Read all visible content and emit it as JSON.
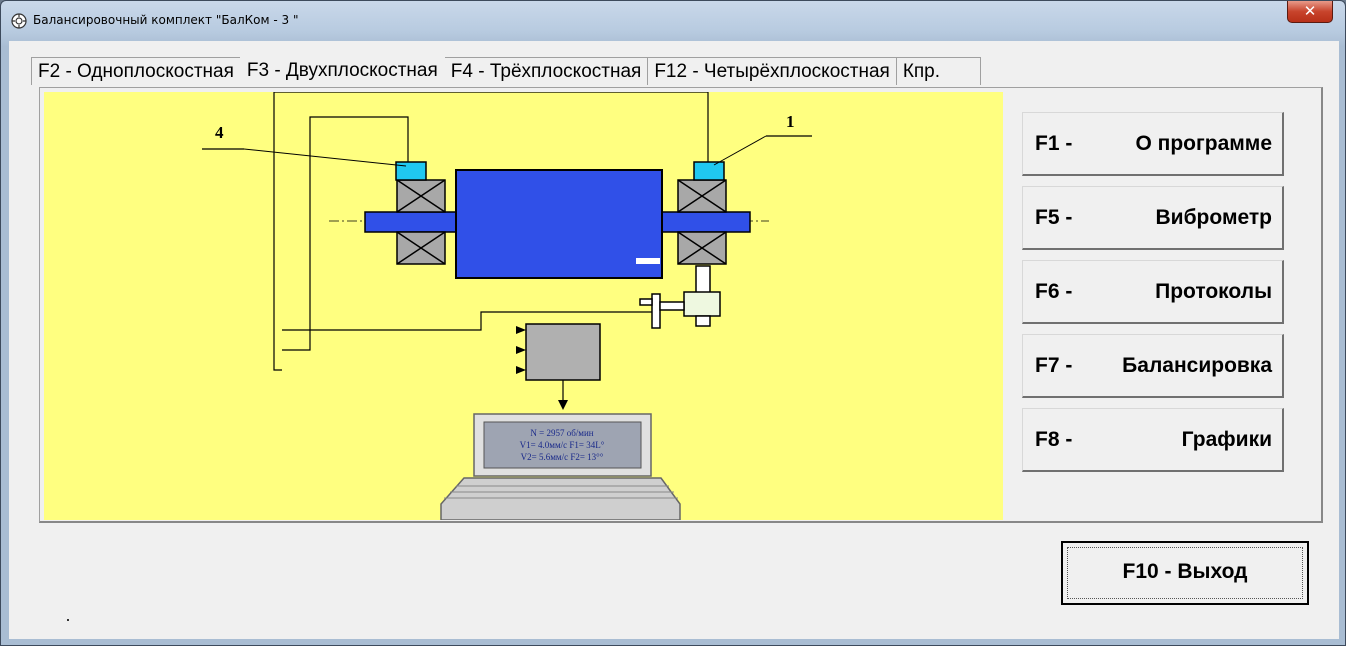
{
  "window": {
    "title": "Балансировочный комплект \"БалКом - 3 \"",
    "close_glyph": "✕"
  },
  "tabs": [
    {
      "label": "F2 - Одноплоскостная",
      "active": false
    },
    {
      "label": "F3 - Двухплоскостная",
      "active": true
    },
    {
      "label": "F4 - Трёхплоскостная",
      "active": false
    },
    {
      "label": "F12 - Четырёхплоскостная",
      "active": false
    },
    {
      "label": "Кпр.",
      "active": false
    }
  ],
  "diagram": {
    "sensor_labels": [
      "4",
      "1"
    ],
    "screen_lines": [
      "N = 2957 об/мин",
      "V1= 4.0мм/с   F1= 34L°",
      "V2= 5.6мм/с   F2= 13°°"
    ]
  },
  "buttons": [
    {
      "key": "F1 -",
      "label": "О программе"
    },
    {
      "key": "F5 -",
      "label": "Виброметр"
    },
    {
      "key": "F6 -",
      "label": "Протоколы"
    },
    {
      "key": "F7 -",
      "label": "Балансировка"
    },
    {
      "key": "F8 -",
      "label": "Графики"
    }
  ],
  "exit_button": {
    "label": "F10 - Выход"
  },
  "status_mark": "."
}
